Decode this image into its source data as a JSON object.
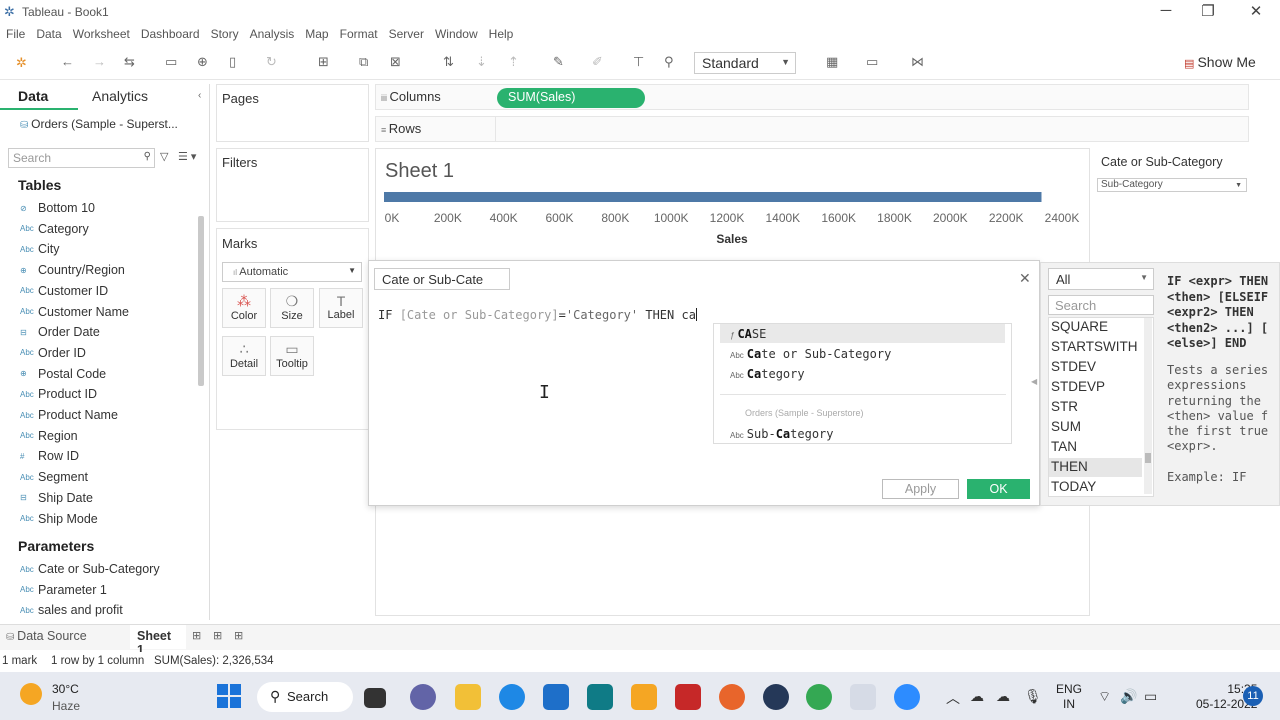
{
  "window": {
    "title": "Tableau - Book1"
  },
  "menu": [
    "File",
    "Data",
    "Worksheet",
    "Dashboard",
    "Story",
    "Analysis",
    "Map",
    "Format",
    "Server",
    "Window",
    "Help"
  ],
  "toolbar": {
    "fit_select": "Standard",
    "show_me": "Show Me"
  },
  "left_pane": {
    "tab_data": "Data",
    "tab_analytics": "Analytics",
    "data_source": "Orders (Sample - Superst...",
    "search_placeholder": "Search",
    "tables_title": "Tables",
    "fields": [
      {
        "name": "Bottom 10",
        "type": "set"
      },
      {
        "name": "Category",
        "type": "abc"
      },
      {
        "name": "City",
        "type": "abc"
      },
      {
        "name": "Country/Region",
        "type": "geo"
      },
      {
        "name": "Customer ID",
        "type": "abc"
      },
      {
        "name": "Customer Name",
        "type": "abc"
      },
      {
        "name": "Order Date",
        "type": "date"
      },
      {
        "name": "Order ID",
        "type": "abc"
      },
      {
        "name": "Postal Code",
        "type": "geo"
      },
      {
        "name": "Product ID",
        "type": "abc"
      },
      {
        "name": "Product Name",
        "type": "abc"
      },
      {
        "name": "Region",
        "type": "abc"
      },
      {
        "name": "Row ID",
        "type": "num"
      },
      {
        "name": "Segment",
        "type": "abc"
      },
      {
        "name": "Ship Date",
        "type": "date"
      },
      {
        "name": "Ship Mode",
        "type": "abc"
      }
    ],
    "parameters_title": "Parameters",
    "parameters": [
      {
        "name": "Cate or Sub-Category",
        "type": "abc"
      },
      {
        "name": "Parameter 1",
        "type": "abc"
      },
      {
        "name": "sales and profit",
        "type": "abc"
      }
    ]
  },
  "cards": {
    "pages": "Pages",
    "filters": "Filters",
    "marks": "Marks",
    "mark_type": "Automatic",
    "mark_buttons": [
      "Color",
      "Size",
      "Label",
      "Detail",
      "Tooltip"
    ]
  },
  "shelves": {
    "columns": "Columns",
    "rows": "Rows",
    "columns_pill": "SUM(Sales)"
  },
  "sheet": {
    "title": "Sheet 1"
  },
  "chart_data": {
    "type": "bar",
    "orientation": "horizontal",
    "categories": [
      ""
    ],
    "values": [
      2326534
    ],
    "xlabel": "Sales",
    "xlim": [
      0,
      2400000
    ],
    "x_ticks": [
      "0K",
      "200K",
      "400K",
      "600K",
      "800K",
      "1000K",
      "1200K",
      "1400K",
      "1600K",
      "1800K",
      "2000K",
      "2200K",
      "2400K"
    ],
    "bar_color": "#4e79a7"
  },
  "parameter_control": {
    "title": "Cate or Sub-Category",
    "value": "Sub-Category"
  },
  "calc_dialog": {
    "name": "Cate or Sub-Cate",
    "formula_prefix": "IF ",
    "formula_field": "[Cate or Sub-Category]",
    "formula_eq": "=",
    "formula_string": "'Category'",
    "formula_then": " THEN ca",
    "autocomplete": {
      "items": [
        {
          "icon": "ƒ",
          "match": "CA",
          "rest": "SE"
        },
        {
          "icon": "Abc",
          "match": "Ca",
          "rest": "te or Sub-Category"
        },
        {
          "icon": "Abc",
          "match": "Ca",
          "rest": "tegory"
        }
      ],
      "group_label": "Orders (Sample - Superstore)",
      "group_items": [
        {
          "icon": "Abc",
          "pre": "Sub-",
          "match": "Ca",
          "rest": "tegory"
        }
      ]
    },
    "apply": "Apply",
    "ok": "OK"
  },
  "function_panel": {
    "filter": "All",
    "search_placeholder": "Search",
    "functions": [
      "SQUARE",
      "STARTSWITH",
      "STDEV",
      "STDEVP",
      "STR",
      "SUM",
      "TAN",
      "THEN",
      "TODAY"
    ],
    "selected": "THEN",
    "syntax_lines": [
      "IF <expr> THEN",
      "<then> [ELSEIF",
      "<expr2> THEN",
      "<then2> ...] [",
      "<else>] END"
    ],
    "description_lines": [
      "Tests a series",
      "expressions",
      "returning the",
      "<then> value f",
      "the first true",
      "<expr>.",
      "",
      "Example: IF"
    ]
  },
  "bottom_tabs": {
    "data_source": "Data Source",
    "sheet": "Sheet 1"
  },
  "status": {
    "marks": "1 mark",
    "dims": "1 row by 1 column",
    "sum": "SUM(Sales): 2,326,534"
  },
  "taskbar": {
    "temp": "30°C",
    "weather": "Haze",
    "search": "Search",
    "lang_1": "ENG",
    "lang_2": "IN",
    "time": "15:35",
    "date": "05-12-2022",
    "notifications": "11"
  }
}
